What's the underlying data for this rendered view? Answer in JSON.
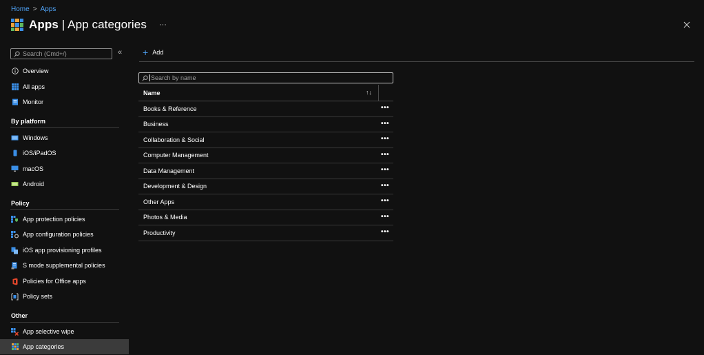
{
  "breadcrumb": {
    "home": "Home",
    "separator": ">",
    "current": "Apps"
  },
  "header": {
    "title_bold": "Apps",
    "title_rest": " | App categories",
    "more": "···"
  },
  "sidebar": {
    "search_placeholder": "Search (Cmd+/)",
    "collapse": "«",
    "items_top": [
      {
        "label": "Overview",
        "icon": "info-icon"
      },
      {
        "label": "All apps",
        "icon": "grid-icon"
      },
      {
        "label": "Monitor",
        "icon": "monitor-icon"
      }
    ],
    "section_platform": "By platform",
    "items_platform": [
      {
        "label": "Windows",
        "icon": "windows-icon"
      },
      {
        "label": "iOS/iPadOS",
        "icon": "ios-icon"
      },
      {
        "label": "macOS",
        "icon": "macos-icon"
      },
      {
        "label": "Android",
        "icon": "android-icon"
      }
    ],
    "section_policy": "Policy",
    "items_policy": [
      {
        "label": "App protection policies",
        "icon": "app-protection-icon"
      },
      {
        "label": "App configuration policies",
        "icon": "app-configuration-icon"
      },
      {
        "label": "iOS app provisioning profiles",
        "icon": "provisioning-icon"
      },
      {
        "label": "S mode supplemental policies",
        "icon": "s-mode-icon"
      },
      {
        "label": "Policies for Office apps",
        "icon": "office-icon"
      },
      {
        "label": "Policy sets",
        "icon": "policy-sets-icon"
      }
    ],
    "section_other": "Other",
    "items_other": [
      {
        "label": "App selective wipe",
        "icon": "selective-wipe-icon"
      },
      {
        "label": "App categories",
        "icon": "app-categories-icon"
      }
    ]
  },
  "toolbar": {
    "add_label": "Add"
  },
  "list": {
    "search_placeholder": "Search by name",
    "column_name": "Name",
    "sort": "↑↓",
    "rows": [
      "Books & Reference",
      "Business",
      "Collaboration & Social",
      "Computer Management",
      "Data Management",
      "Development & Design",
      "Other Apps",
      "Photos & Media",
      "Productivity"
    ],
    "row_more": "•••"
  },
  "colors": {
    "accent": "#4fa3f7",
    "background": "#111111",
    "active_item": "#3b3b3b"
  }
}
